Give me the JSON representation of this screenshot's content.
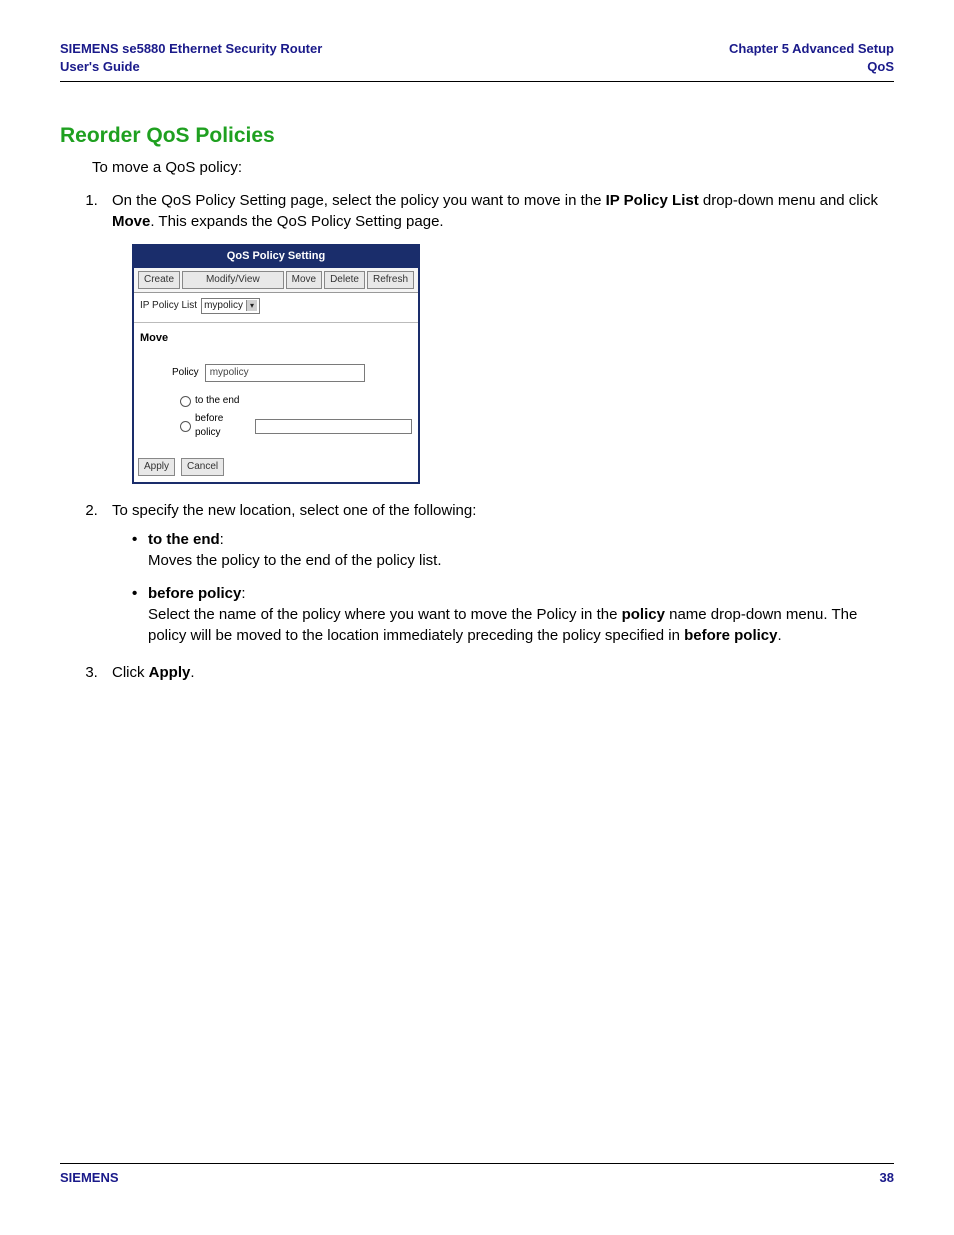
{
  "header": {
    "product_line1": "SIEMENS se5880 Ethernet Security Router",
    "product_line2": "User's Guide",
    "chapter": "Chapter 5  Advanced Setup",
    "section": "QoS"
  },
  "section_title": "Reorder QoS Policies",
  "intro": "To move a QoS policy:",
  "steps": {
    "s1_a": "On the QoS Policy Setting page, select the policy you want to move in the ",
    "s1_b_bold": "IP Policy List",
    "s1_c": " drop-down menu and click ",
    "s1_d_bold": "Move",
    "s1_e": ". This expands the QoS Policy Setting page.",
    "s2": "To specify the new location, select one of the following:",
    "s2_sub": {
      "a_bold": "to the end",
      "a_colon": ":",
      "a_body": "Moves the policy to the end of the policy list.",
      "b_bold": "before policy",
      "b_colon": ":",
      "b_body_1": "Select the name of the policy where you want to move the Policy in the ",
      "b_body_bold1": "policy",
      "b_body_2": " name drop-down menu. The policy will be moved to the location immediately preceding the policy specified in ",
      "b_body_bold2": "before policy",
      "b_body_3": "."
    },
    "s3_a": "Click ",
    "s3_b_bold": "Apply",
    "s3_c": "."
  },
  "widget": {
    "title": "QoS Policy Setting",
    "btn_create": "Create",
    "btn_modify": "Modify/View",
    "btn_move": "Move",
    "btn_delete": "Delete",
    "btn_refresh": "Refresh",
    "ip_policy_label": "IP Policy List",
    "ip_policy_value": "mypolicy",
    "move_label": "Move",
    "policy_label": "Policy",
    "policy_value": "mypolicy",
    "radio_end": "to the end",
    "radio_before": "before policy",
    "btn_apply": "Apply",
    "btn_cancel": "Cancel"
  },
  "footer": {
    "brand": "SIEMENS",
    "page_num": "38"
  }
}
